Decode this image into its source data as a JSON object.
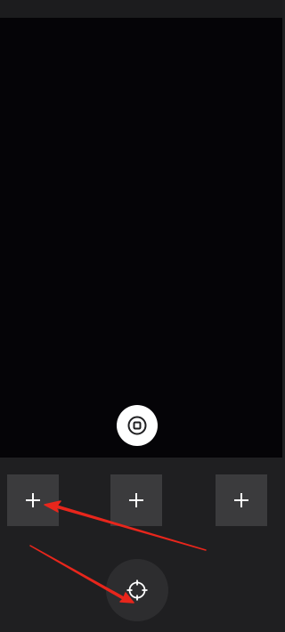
{
  "icons": {
    "shutter": "record-stop-icon",
    "slot": "plus-icon",
    "locate": "crosshair-icon"
  },
  "slots": [
    {
      "icon": "plus-icon"
    },
    {
      "icon": "plus-icon"
    },
    {
      "icon": "plus-icon"
    }
  ],
  "colors": {
    "viewfinder": "#050407",
    "tray": "#1f1f21",
    "slot": "#3b3b3d",
    "locate": "#2d2d2f",
    "shutter": "#ffffff",
    "annotation": "#e8261c"
  }
}
